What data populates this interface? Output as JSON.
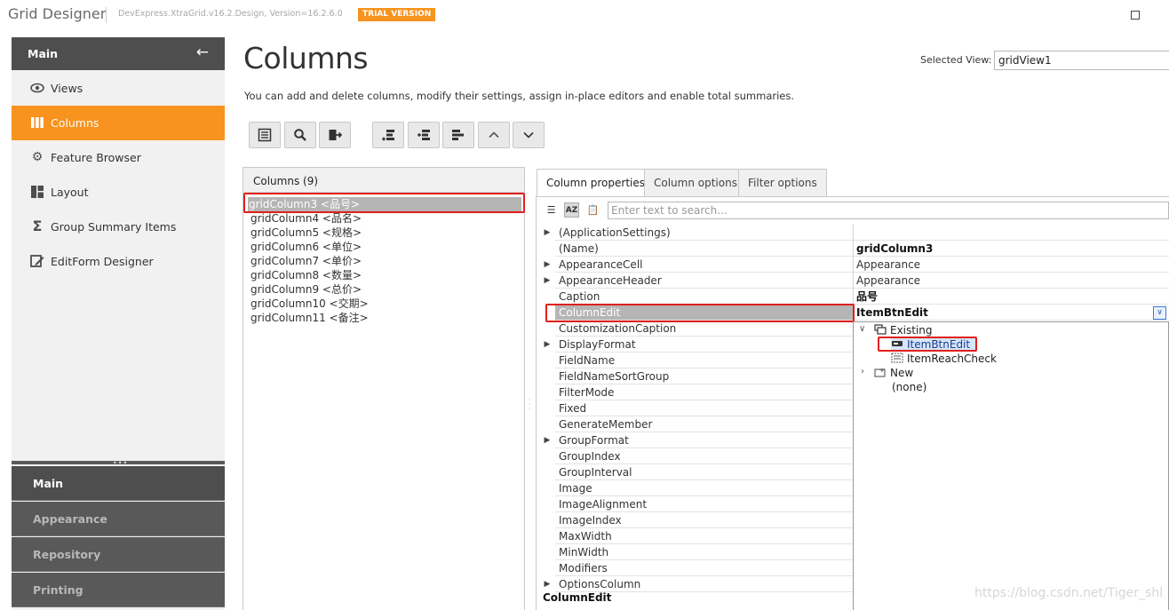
{
  "window": {
    "title": "Grid Designer",
    "version": "DevExpress.XtraGrid.v16.2.Design, Version=16.2.6.0",
    "trial_badge": "TRIAL VERSION"
  },
  "nav": {
    "header": "Main",
    "items": [
      {
        "label": "Views",
        "icon": "eye-icon"
      },
      {
        "label": "Columns",
        "icon": "columns-icon",
        "active": true
      },
      {
        "label": "Feature Browser",
        "icon": "gear-icon"
      },
      {
        "label": "Layout",
        "icon": "layout-icon"
      },
      {
        "label": "Group Summary Items",
        "icon": "sigma-icon"
      },
      {
        "label": "EditForm Designer",
        "icon": "edit-form-icon"
      }
    ],
    "sections": [
      "Main",
      "Appearance",
      "Repository",
      "Printing"
    ]
  },
  "page": {
    "title": "Columns",
    "description": "You can add and delete columns, modify their settings, assign in-place editors and enable total summaries.",
    "selected_view_label": "Selected View:",
    "selected_view": "gridView1"
  },
  "toolbar": {
    "buttons": [
      "show-field-list-icon",
      "search-icon",
      "exit-icon",
      "add-column-icon",
      "insert-column-icon",
      "remove-column-icon",
      "move-up-icon",
      "move-down-icon"
    ]
  },
  "columns_panel": {
    "header": "Columns (9)",
    "items": [
      "gridColumn3 <品号>",
      "gridColumn4 <品名>",
      "gridColumn5 <规格>",
      "gridColumn6 <单位>",
      "gridColumn7 <单价>",
      "gridColumn8 <数量>",
      "gridColumn9 <总价>",
      "gridColumn10 <交期>",
      "gridColumn11 <备注>"
    ],
    "selected_index": 0
  },
  "tabs": [
    "Column properties",
    "Column options",
    "Filter options"
  ],
  "properties": {
    "search_placeholder": "Enter text to search...",
    "rows": [
      {
        "name": "(ApplicationSettings)",
        "value": "",
        "expandable": true
      },
      {
        "name": "(Name)",
        "value": "gridColumn3",
        "bold": true
      },
      {
        "name": "AppearanceCell",
        "value": "Appearance",
        "expandable": true
      },
      {
        "name": "AppearanceHeader",
        "value": "Appearance",
        "expandable": true
      },
      {
        "name": "Caption",
        "value": "品号",
        "bold": true
      },
      {
        "name": "ColumnEdit",
        "value": "ItemBtnEdit",
        "bold": true,
        "selected": true
      },
      {
        "name": "CustomizationCaption",
        "value": ""
      },
      {
        "name": "DisplayFormat",
        "value": "",
        "expandable": true
      },
      {
        "name": "FieldName",
        "value": ""
      },
      {
        "name": "FieldNameSortGroup",
        "value": ""
      },
      {
        "name": "FilterMode",
        "value": ""
      },
      {
        "name": "Fixed",
        "value": ""
      },
      {
        "name": "GenerateMember",
        "value": ""
      },
      {
        "name": "GroupFormat",
        "value": "",
        "expandable": true
      },
      {
        "name": "GroupIndex",
        "value": ""
      },
      {
        "name": "GroupInterval",
        "value": ""
      },
      {
        "name": "Image",
        "value": ""
      },
      {
        "name": "ImageAlignment",
        "value": ""
      },
      {
        "name": "ImageIndex",
        "value": ""
      },
      {
        "name": "MaxWidth",
        "value": ""
      },
      {
        "name": "MinWidth",
        "value": ""
      },
      {
        "name": "Modifiers",
        "value": ""
      },
      {
        "name": "OptionsColumn",
        "value": "",
        "expandable": true
      }
    ],
    "description_title": "ColumnEdit"
  },
  "dropdown": {
    "existing_label": "Existing",
    "existing_items": [
      "ItemBtnEdit",
      "ItemReachCheck"
    ],
    "new_label": "New",
    "none_label": "(none)"
  },
  "watermark": "https://blog.csdn.net/Tiger_shl",
  "colors": {
    "accent": "#f7931e",
    "nav_dark": "#4e4e4e",
    "highlight_box": "#e0201b"
  }
}
